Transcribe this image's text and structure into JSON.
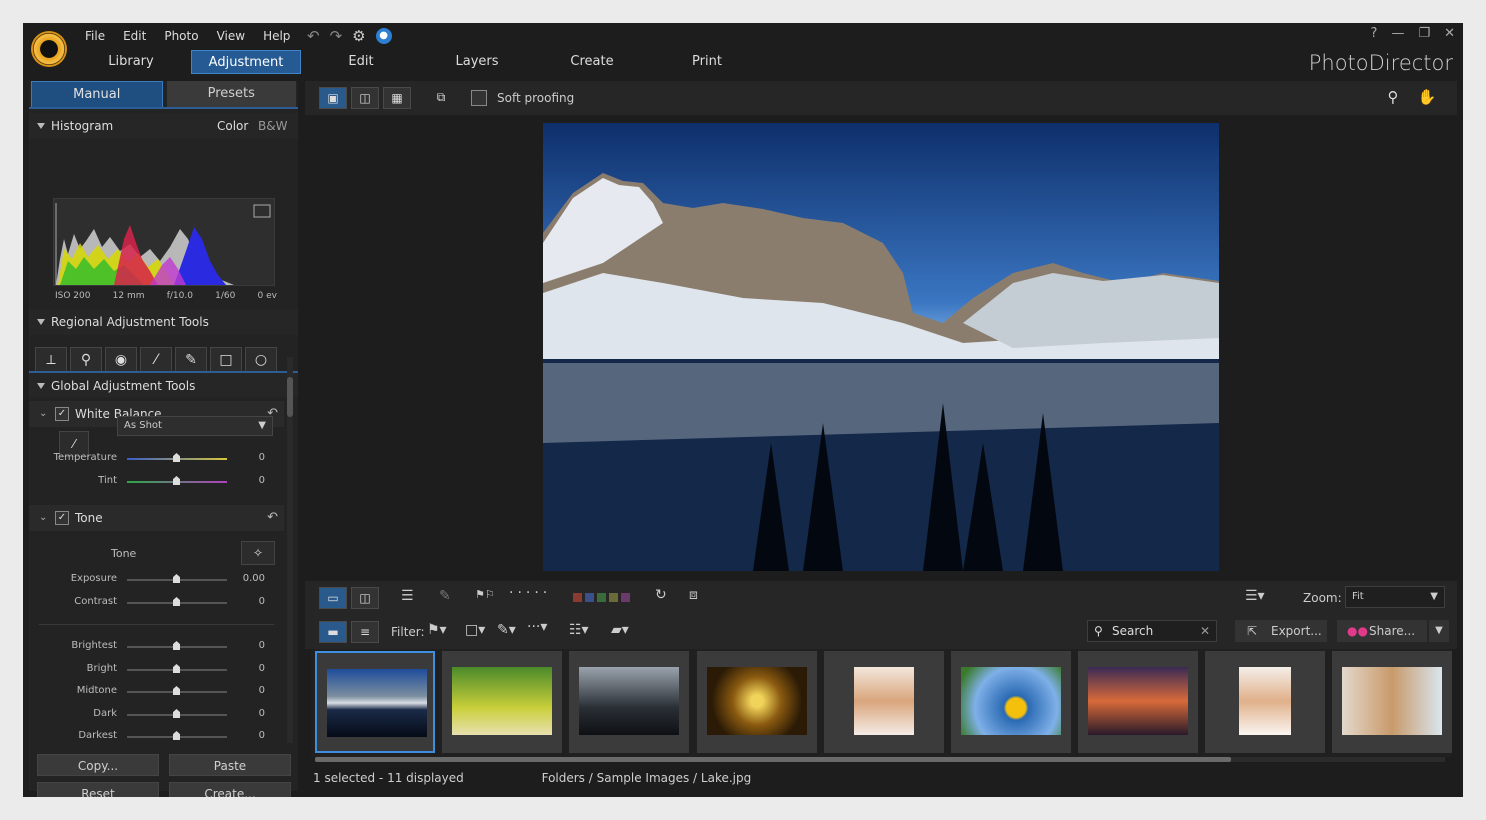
{
  "menu": [
    "File",
    "Edit",
    "Photo",
    "View",
    "Help"
  ],
  "modules": {
    "library": "Library",
    "adjustment": "Adjustment",
    "edit": "Edit",
    "layers": "Layers",
    "create": "Create",
    "print": "Print"
  },
  "brand": "PhotoDirector",
  "window": {
    "help": "?"
  },
  "panel": {
    "manual": "Manual",
    "presets": "Presets"
  },
  "histogram": {
    "title": "Histogram",
    "color": "Color",
    "bw": "B&W",
    "iso": "ISO 200",
    "focal": "12 mm",
    "aperture": "f/10.0",
    "shutter": "1/60",
    "ev": "0 ev"
  },
  "regional": {
    "title": "Regional Adjustment Tools"
  },
  "global": {
    "title": "Global Adjustment Tools"
  },
  "wb": {
    "title": "White Balance",
    "preset": "As Shot",
    "temp_label": "Temperature",
    "temp_val": "0",
    "tint_label": "Tint",
    "tint_val": "0"
  },
  "tone": {
    "title": "Tone",
    "sub": "Tone",
    "sliders": [
      {
        "label": "Exposure",
        "val": "0.00"
      },
      {
        "label": "Contrast",
        "val": "0"
      },
      {
        "label": "Brightest",
        "val": "0"
      },
      {
        "label": "Bright",
        "val": "0"
      },
      {
        "label": "Midtone",
        "val": "0"
      },
      {
        "label": "Dark",
        "val": "0"
      },
      {
        "label": "Darkest",
        "val": "0"
      }
    ]
  },
  "buttons": {
    "copy": "Copy...",
    "paste": "Paste",
    "reset": "Reset",
    "create": "Create..."
  },
  "toolbar": {
    "soft_proofing": "Soft proofing"
  },
  "zoom": {
    "label": "Zoom:",
    "value": "Fit"
  },
  "filter": {
    "label": "Filter:"
  },
  "search": {
    "placeholder": "Search"
  },
  "export": "Export...",
  "share": "Share...",
  "status": {
    "selection": "1 selected - 11 displayed",
    "path": "Folders / Sample Images / Lake.jpg"
  },
  "colors": {
    "accent": "#2d6fb5",
    "label_colors": [
      "#8a3a2e",
      "#3b4f88",
      "#3a6b3a",
      "#6b6b3a",
      "#6a3a6a"
    ]
  }
}
